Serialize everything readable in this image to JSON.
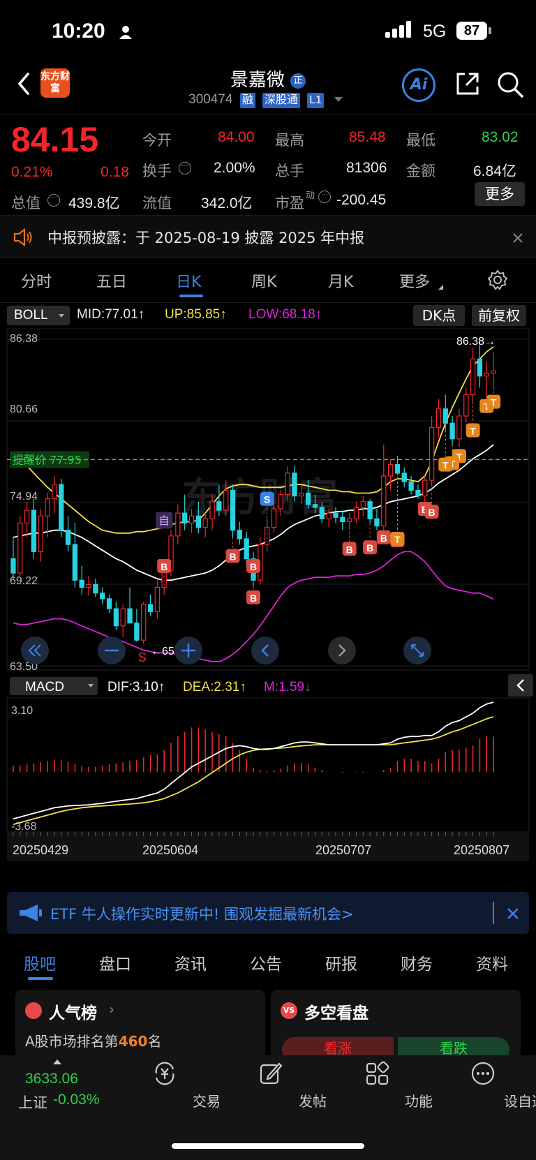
{
  "status": {
    "time": "10:20",
    "network": "5G",
    "battery": "87"
  },
  "header": {
    "logo": "东方财富",
    "stock_name": "景嘉微",
    "badge": "正",
    "code": "300474",
    "tags": [
      "融",
      "深股通",
      "L1"
    ],
    "ai_label": "Ai"
  },
  "quote": {
    "price": "84.15",
    "change_pct": "0.21%",
    "change": "0.18",
    "open_label": "今开",
    "open": "84.00",
    "high_label": "最高",
    "high": "85.48",
    "low_label": "最低",
    "low": "83.02",
    "turnover_label": "换手",
    "turnover": "2.00%",
    "volume_label": "总手",
    "volume": "81306",
    "amount_label": "金额",
    "amount": "6.84亿",
    "mktcap_label": "总值",
    "mktcap": "439.8亿",
    "float_label": "流值",
    "float": "342.0亿",
    "pe_label": "市盈",
    "pe_sup": "动",
    "pe": "-200.45",
    "more": "更多"
  },
  "notice": {
    "text": "中报预披露：于 2025-08-19 披露 2025 年中报"
  },
  "tabs": [
    "分时",
    "五日",
    "日K",
    "周K",
    "月K",
    "更多"
  ],
  "toolbar": {
    "indicator": "BOLL",
    "mid": "MID:77.01↑",
    "up": "UP:85.85↑",
    "low": "LOW:68.18↑",
    "dk": "DK点",
    "adjust": "前复权"
  },
  "price_axis": [
    "86.38",
    "80.66",
    "74.94",
    "69.22",
    "63.50"
  ],
  "alert": {
    "label": "提醒价 77.95",
    "value": 77.95
  },
  "max_label": "86.38→",
  "min_label": "←65.03",
  "watermark": "东方财富",
  "macd": {
    "indicator": "MACD",
    "dif": "DIF:3.10↑",
    "dea": "DEA:2.31↑",
    "m": "M:1.59↓",
    "top": "3.10",
    "bottom": "-3.68"
  },
  "dates": [
    "20250429",
    "20250604",
    "20250707",
    "20250807"
  ],
  "colors": {
    "up": "#f2262a",
    "down": "#27d3e0",
    "mid": "#ffffff",
    "upper": "#f2e04a",
    "lower": "#e020e0",
    "accent": "#3a82e6"
  },
  "chart_data": {
    "type": "candlestick",
    "ylim": [
      63.5,
      86.38
    ],
    "candles": [
      {
        "o": 71.0,
        "h": 72.5,
        "l": 69.5,
        "c": 70.0
      },
      {
        "o": 70.0,
        "h": 74.0,
        "l": 69.8,
        "c": 73.5
      },
      {
        "o": 73.5,
        "h": 75.0,
        "l": 72.5,
        "c": 74.4
      },
      {
        "o": 74.4,
        "h": 75.2,
        "l": 71.0,
        "c": 71.5
      },
      {
        "o": 71.5,
        "h": 74.5,
        "l": 70.8,
        "c": 74.0
      },
      {
        "o": 74.0,
        "h": 75.6,
        "l": 72.5,
        "c": 75.2
      },
      {
        "o": 75.2,
        "h": 76.8,
        "l": 74.2,
        "c": 76.2
      },
      {
        "o": 76.2,
        "h": 76.6,
        "l": 72.5,
        "c": 73.0
      },
      {
        "o": 73.0,
        "h": 74.0,
        "l": 71.5,
        "c": 72.0
      },
      {
        "o": 72.0,
        "h": 73.5,
        "l": 69.0,
        "c": 69.5
      },
      {
        "o": 69.5,
        "h": 70.5,
        "l": 68.5,
        "c": 69.0
      },
      {
        "o": 69.0,
        "h": 69.8,
        "l": 68.4,
        "c": 69.2
      },
      {
        "o": 69.2,
        "h": 69.6,
        "l": 68.3,
        "c": 68.6
      },
      {
        "o": 68.6,
        "h": 69.0,
        "l": 67.8,
        "c": 68.2
      },
      {
        "o": 68.2,
        "h": 68.5,
        "l": 67.2,
        "c": 67.5
      },
      {
        "o": 67.5,
        "h": 68.0,
        "l": 66.0,
        "c": 66.3
      },
      {
        "o": 66.3,
        "h": 67.8,
        "l": 65.5,
        "c": 67.5
      },
      {
        "o": 67.5,
        "h": 69.0,
        "l": 67.0,
        "c": 66.5
      },
      {
        "o": 66.5,
        "h": 67.5,
        "l": 65.2,
        "c": 65.3
      },
      {
        "o": 65.3,
        "h": 68.0,
        "l": 65.03,
        "c": 67.8
      },
      {
        "o": 67.8,
        "h": 68.5,
        "l": 67.0,
        "c": 67.3
      },
      {
        "o": 67.3,
        "h": 69.5,
        "l": 66.8,
        "c": 69.0
      },
      {
        "o": 69.0,
        "h": 70.5,
        "l": 68.5,
        "c": 70.2
      },
      {
        "o": 70.2,
        "h": 73.0,
        "l": 69.8,
        "c": 72.6
      },
      {
        "o": 72.6,
        "h": 74.8,
        "l": 72.0,
        "c": 74.2
      },
      {
        "o": 74.2,
        "h": 75.5,
        "l": 73.0,
        "c": 73.5
      },
      {
        "o": 73.5,
        "h": 74.5,
        "l": 72.8,
        "c": 74.0
      },
      {
        "o": 74.0,
        "h": 75.0,
        "l": 72.8,
        "c": 73.2
      },
      {
        "o": 73.2,
        "h": 74.2,
        "l": 72.5,
        "c": 73.8
      },
      {
        "o": 73.8,
        "h": 75.5,
        "l": 73.0,
        "c": 75.0
      },
      {
        "o": 75.0,
        "h": 76.2,
        "l": 74.0,
        "c": 74.4
      },
      {
        "o": 74.4,
        "h": 76.5,
        "l": 74.0,
        "c": 75.8
      },
      {
        "o": 75.8,
        "h": 76.2,
        "l": 72.5,
        "c": 73.0
      },
      {
        "o": 73.0,
        "h": 73.6,
        "l": 72.0,
        "c": 72.4
      },
      {
        "o": 72.4,
        "h": 72.9,
        "l": 70.5,
        "c": 71.0
      },
      {
        "o": 71.0,
        "h": 71.5,
        "l": 69.0,
        "c": 69.5
      },
      {
        "o": 69.5,
        "h": 72.5,
        "l": 69.2,
        "c": 72.0
      },
      {
        "o": 72.0,
        "h": 73.8,
        "l": 71.5,
        "c": 73.2
      },
      {
        "o": 73.2,
        "h": 75.0,
        "l": 72.8,
        "c": 74.5
      },
      {
        "o": 74.5,
        "h": 75.8,
        "l": 74.0,
        "c": 75.5
      },
      {
        "o": 75.5,
        "h": 77.5,
        "l": 75.0,
        "c": 77.0
      },
      {
        "o": 77.0,
        "h": 77.5,
        "l": 75.0,
        "c": 75.4
      },
      {
        "o": 75.4,
        "h": 76.2,
        "l": 74.8,
        "c": 75.6
      },
      {
        "o": 75.6,
        "h": 76.5,
        "l": 74.5,
        "c": 74.8
      },
      {
        "o": 74.8,
        "h": 75.5,
        "l": 74.2,
        "c": 74.6
      },
      {
        "o": 74.6,
        "h": 75.0,
        "l": 73.5,
        "c": 73.8
      },
      {
        "o": 73.8,
        "h": 74.5,
        "l": 73.2,
        "c": 74.2
      },
      {
        "o": 74.2,
        "h": 74.6,
        "l": 73.5,
        "c": 73.9
      },
      {
        "o": 73.9,
        "h": 74.4,
        "l": 73.0,
        "c": 73.6
      },
      {
        "o": 73.6,
        "h": 74.2,
        "l": 73.2,
        "c": 73.8
      },
      {
        "o": 73.8,
        "h": 75.0,
        "l": 73.5,
        "c": 74.6
      },
      {
        "o": 74.6,
        "h": 75.4,
        "l": 74.0,
        "c": 75.0
      },
      {
        "o": 75.0,
        "h": 75.2,
        "l": 73.5,
        "c": 73.8
      },
      {
        "o": 73.8,
        "h": 74.5,
        "l": 73.0,
        "c": 73.3
      },
      {
        "o": 73.3,
        "h": 79.0,
        "l": 73.0,
        "c": 76.8
      },
      {
        "o": 76.8,
        "h": 78.0,
        "l": 75.8,
        "c": 77.6
      },
      {
        "o": 77.6,
        "h": 78.2,
        "l": 77.0,
        "c": 77.0
      },
      {
        "o": 77.0,
        "h": 77.4,
        "l": 76.0,
        "c": 76.4
      },
      {
        "o": 76.4,
        "h": 76.8,
        "l": 75.5,
        "c": 75.8
      },
      {
        "o": 75.8,
        "h": 76.2,
        "l": 75.2,
        "c": 75.4
      },
      {
        "o": 75.4,
        "h": 76.8,
        "l": 75.0,
        "c": 76.5
      },
      {
        "o": 76.5,
        "h": 81.0,
        "l": 76.2,
        "c": 80.2
      },
      {
        "o": 80.2,
        "h": 82.2,
        "l": 79.5,
        "c": 81.5
      },
      {
        "o": 81.5,
        "h": 82.5,
        "l": 80.0,
        "c": 80.5
      },
      {
        "o": 80.5,
        "h": 81.0,
        "l": 79.0,
        "c": 79.4
      },
      {
        "o": 79.4,
        "h": 81.5,
        "l": 79.0,
        "c": 81.0
      },
      {
        "o": 81.0,
        "h": 83.0,
        "l": 80.5,
        "c": 82.5
      },
      {
        "o": 82.5,
        "h": 85.8,
        "l": 82.0,
        "c": 85.0
      },
      {
        "o": 85.0,
        "h": 86.38,
        "l": 83.0,
        "c": 83.8
      },
      {
        "o": 83.8,
        "h": 84.8,
        "l": 82.5,
        "c": 84.0
      },
      {
        "o": 84.0,
        "h": 85.48,
        "l": 83.02,
        "c": 84.15
      }
    ],
    "mid": [
      72.5,
      72.6,
      72.7,
      72.8,
      72.8,
      72.9,
      73.0,
      73.0,
      72.9,
      72.7,
      72.5,
      72.2,
      71.9,
      71.6,
      71.3,
      71.0,
      70.8,
      70.5,
      70.2,
      70.0,
      69.8,
      69.6,
      69.5,
      69.5,
      69.6,
      69.7,
      69.8,
      69.9,
      70.0,
      70.2,
      70.5,
      70.9,
      71.3,
      71.6,
      71.8,
      71.9,
      72.0,
      72.2,
      72.4,
      72.7,
      73.1,
      73.4,
      73.6,
      73.8,
      74.0,
      74.1,
      74.2,
      74.3,
      74.3,
      74.4,
      74.4,
      74.5,
      74.5,
      74.6,
      74.8,
      75.0,
      75.1,
      75.2,
      75.3,
      75.4,
      75.6,
      75.9,
      76.3,
      76.6,
      76.9,
      77.2,
      77.6,
      78.0,
      78.3,
      78.6,
      79.0
    ],
    "upper": [
      78.0,
      77.8,
      77.5,
      77.0,
      76.5,
      76.0,
      75.6,
      75.2,
      74.8,
      74.4,
      74.0,
      73.6,
      73.3,
      73.0,
      72.9,
      72.8,
      72.8,
      72.8,
      72.9,
      72.9,
      73.0,
      73.1,
      73.2,
      73.4,
      73.5,
      73.6,
      73.6,
      73.7,
      74.2,
      74.8,
      75.4,
      75.9,
      76.1,
      76.2,
      76.2,
      76.1,
      76.0,
      76.0,
      76.0,
      76.0,
      76.1,
      76.2,
      76.2,
      76.1,
      76.0,
      75.9,
      75.8,
      75.8,
      75.7,
      75.7,
      75.6,
      75.6,
      75.6,
      75.7,
      76.0,
      76.4,
      76.6,
      76.6,
      76.5,
      76.4,
      76.8,
      77.8,
      79.2,
      80.5,
      81.6,
      82.6,
      83.6,
      84.5,
      85.0,
      85.5,
      85.85
    ],
    "lower": [
      66.5,
      66.4,
      66.4,
      66.5,
      66.6,
      66.7,
      66.8,
      66.8,
      66.7,
      66.5,
      66.3,
      66.1,
      65.9,
      65.7,
      65.5,
      65.4,
      65.2,
      65.0,
      64.8,
      64.6,
      64.5,
      64.4,
      64.4,
      64.4,
      64.3,
      64.2,
      64.1,
      64.0,
      63.9,
      63.8,
      63.8,
      64.0,
      64.3,
      64.7,
      65.2,
      65.7,
      66.3,
      67.0,
      67.7,
      68.4,
      69.0,
      69.3,
      69.5,
      69.6,
      69.7,
      69.7,
      69.7,
      69.8,
      69.8,
      69.8,
      69.9,
      69.9,
      70.0,
      70.2,
      70.5,
      70.9,
      71.3,
      71.5,
      71.5,
      71.2,
      70.8,
      70.2,
      69.6,
      69.1,
      68.9,
      68.8,
      68.7,
      68.6,
      68.6,
      68.4,
      68.18
    ],
    "macd_dif": [
      -3.2,
      -3.1,
      -3.0,
      -2.9,
      -2.8,
      -2.7,
      -2.6,
      -2.55,
      -2.5,
      -2.48,
      -2.46,
      -2.44,
      -2.4,
      -2.36,
      -2.3,
      -2.25,
      -2.2,
      -2.15,
      -2.1,
      -2.0,
      -1.9,
      -1.8,
      -1.6,
      -1.3,
      -1.0,
      -0.7,
      -0.4,
      -0.2,
      0.0,
      0.2,
      0.4,
      0.6,
      0.7,
      0.75,
      0.7,
      0.6,
      0.55,
      0.55,
      0.6,
      0.7,
      0.8,
      0.9,
      0.95,
      0.95,
      0.9,
      0.85,
      0.8,
      0.8,
      0.8,
      0.8,
      0.8,
      0.8,
      0.8,
      0.8,
      0.85,
      0.9,
      1.1,
      1.2,
      1.25,
      1.25,
      1.3,
      1.3,
      1.5,
      1.8,
      2.0,
      2.1,
      2.3,
      2.5,
      2.8,
      3.0,
      3.1
    ],
    "macd_dea": [
      -3.5,
      -3.4,
      -3.3,
      -3.2,
      -3.1,
      -3.0,
      -2.9,
      -2.8,
      -2.72,
      -2.66,
      -2.6,
      -2.56,
      -2.52,
      -2.5,
      -2.48,
      -2.45,
      -2.42,
      -2.4,
      -2.37,
      -2.33,
      -2.28,
      -2.2,
      -2.1,
      -1.95,
      -1.8,
      -1.6,
      -1.4,
      -1.2,
      -0.95,
      -0.7,
      -0.45,
      -0.2,
      0.05,
      0.25,
      0.4,
      0.5,
      0.55,
      0.58,
      0.6,
      0.62,
      0.65,
      0.7,
      0.74,
      0.77,
      0.8,
      0.8,
      0.8,
      0.8,
      0.8,
      0.8,
      0.8,
      0.8,
      0.8,
      0.8,
      0.8,
      0.8,
      0.85,
      0.9,
      0.95,
      1.0,
      1.05,
      1.1,
      1.2,
      1.35,
      1.5,
      1.6,
      1.75,
      1.9,
      2.05,
      2.2,
      2.31
    ],
    "macd_m": [
      0.3,
      0.3,
      0.35,
      0.4,
      0.45,
      0.5,
      0.55,
      0.55,
      0.45,
      0.36,
      0.28,
      0.24,
      0.24,
      0.28,
      0.36,
      0.4,
      0.44,
      0.5,
      0.54,
      0.66,
      0.76,
      0.8,
      1.0,
      1.3,
      1.6,
      1.8,
      2.0,
      2.0,
      1.9,
      1.8,
      1.7,
      1.6,
      1.3,
      1.0,
      0.6,
      0.2,
      0.1,
      0.06,
      0.1,
      0.16,
      0.3,
      0.4,
      0.42,
      0.36,
      0.2,
      0.1,
      0.0,
      0.0,
      -0.02,
      0.0,
      0.02,
      -0.02,
      0.0,
      0.0,
      0.1,
      0.2,
      0.5,
      0.6,
      0.6,
      0.5,
      0.5,
      0.4,
      0.6,
      0.9,
      1.0,
      1.0,
      1.1,
      1.2,
      1.5,
      1.6,
      1.59
    ]
  },
  "banner": {
    "text": "ETF 牛人操作实时更新中! 围观发掘最新机会>"
  },
  "content_tabs": [
    "股吧",
    "盘口",
    "资讯",
    "公告",
    "研报",
    "财务",
    "资料"
  ],
  "cards": {
    "popularity_title": "人气榜",
    "popularity_text_pre": "A股市场排名第",
    "popularity_rank": "460",
    "popularity_text_post": "名",
    "bull_bear_title": "多空看盘",
    "bull": "看涨",
    "bear": "看跌"
  },
  "bottom_bar": {
    "index_value": "3633.06",
    "index_name": "上证",
    "index_change": "-0.03%",
    "items": [
      "交易",
      "发帖",
      "功能",
      "设自选"
    ]
  }
}
